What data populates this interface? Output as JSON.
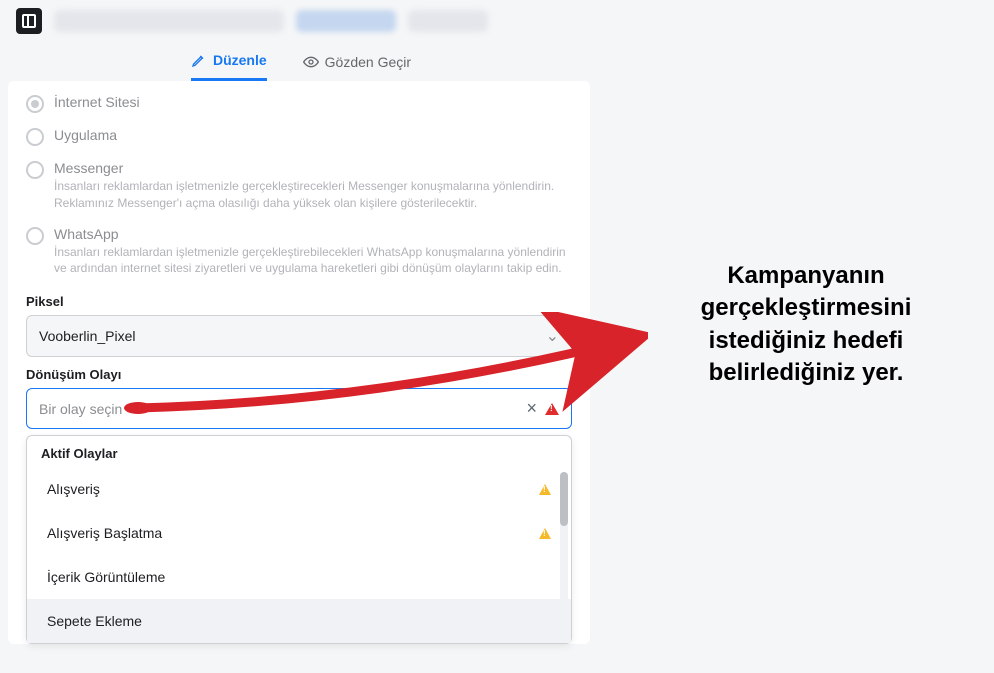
{
  "tabs": {
    "edit": "Düzenle",
    "review": "Gözden Geçir"
  },
  "radios": {
    "website": {
      "title": "İnternet Sitesi"
    },
    "app": {
      "title": "Uygulama"
    },
    "messenger": {
      "title": "Messenger",
      "desc": "İnsanları reklamlardan işletmenizle gerçekleştirecekleri Messenger konuşmalarına yönlendirin. Reklamınız Messenger'ı açma olasılığı daha yüksek olan kişilere gösterilecektir."
    },
    "whatsapp": {
      "title": "WhatsApp",
      "desc": "İnsanları reklamlardan işletmenizle gerçekleştirebilecekleri WhatsApp konuşmalarına yönlendirin ve ardından internet sitesi ziyaretleri ve uygulama hareketleri gibi dönüşüm olaylarını takip edin."
    }
  },
  "pixel": {
    "label": "Piksel",
    "value": "Vooberlin_Pixel"
  },
  "event": {
    "label": "Dönüşüm Olayı",
    "placeholder": "Bir olay seçin"
  },
  "dropdown": {
    "header": "Aktif Olaylar",
    "items": [
      {
        "label": "Alışveriş",
        "warn": true
      },
      {
        "label": "Alışveriş Başlatma",
        "warn": true
      },
      {
        "label": "İçerik Görüntüleme",
        "warn": false
      },
      {
        "label": "Sepete Ekleme",
        "warn": false
      }
    ]
  },
  "annotation": "Kampanyanın gerçekleştirmesini istediğiniz hedefi belirlediğiniz yer."
}
